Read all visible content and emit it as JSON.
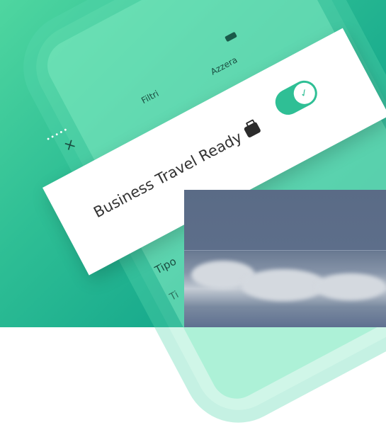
{
  "phone": {
    "status_dots": "•••••",
    "close_icon": "×",
    "title": "Filtri",
    "reset_label": "Azzera",
    "section_label": "Tipo",
    "section_sub": "Ti"
  },
  "card": {
    "label": "Business Travel Ready",
    "toggle_on": true,
    "check_icon": "✓"
  },
  "colors": {
    "accent": "#2fbf95",
    "background_start": "#4fd6a0",
    "background_end": "#0f9a85"
  }
}
